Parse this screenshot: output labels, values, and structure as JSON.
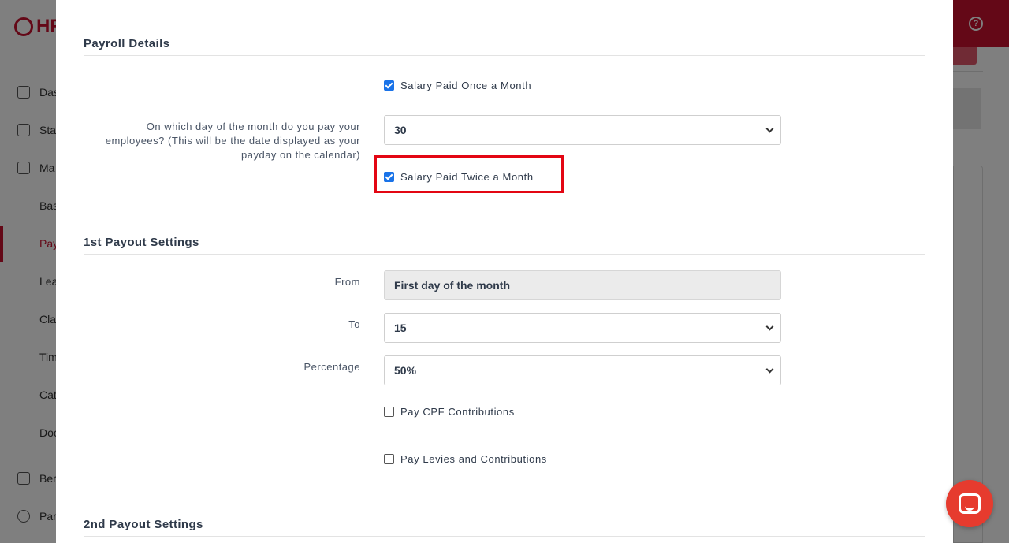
{
  "background": {
    "logo_text": "HR",
    "sidebar": {
      "items": [
        {
          "label": "Das",
          "icon": "chart-line-icon"
        },
        {
          "label": "Sta",
          "icon": "staff-icon"
        },
        {
          "label": "Ma",
          "icon": "building-icon"
        }
      ],
      "subitems": [
        "Bas",
        "Pay",
        "Lea",
        "Cla",
        "Tim",
        "Cat",
        "Doc"
      ],
      "bottom_items": [
        {
          "label": "Ber",
          "icon": "gift-icon"
        },
        {
          "label": "Par",
          "icon": "exchange-icon"
        }
      ]
    },
    "help_icon_text": "?"
  },
  "modal": {
    "payroll_details": {
      "title": "Payroll Details",
      "once_a_month": {
        "label": "Salary Paid Once a Month",
        "checked": true
      },
      "payday_question": "On which day of the month do you pay your employees? (This will be the date displayed as your payday on the calendar)",
      "payday_value": "30",
      "twice_a_month": {
        "label": "Salary Paid Twice a Month",
        "checked": true
      }
    },
    "first_payout": {
      "title": "1st Payout Settings",
      "from_label": "From",
      "from_value": "First day of the month",
      "to_label": "To",
      "to_value": "15",
      "percentage_label": "Percentage",
      "percentage_value": "50%",
      "cpf": {
        "label": "Pay CPF Contributions",
        "checked": false
      },
      "levies": {
        "label": "Pay Levies and Contributions",
        "checked": false
      }
    },
    "second_payout": {
      "title": "2nd Payout Settings"
    }
  },
  "colors": {
    "brand_red": "#c8102e",
    "checkbox_blue": "#1a73e8",
    "highlight_red": "#e30613",
    "chat_button": "#e63b2e"
  }
}
